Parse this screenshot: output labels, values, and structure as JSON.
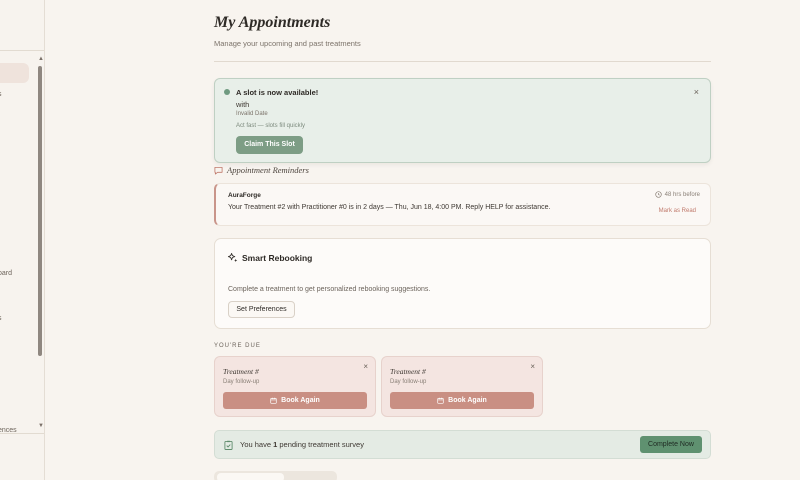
{
  "sidebar": {
    "fragments": [
      {
        "text": "s"
      },
      {
        "text": "oard"
      },
      {
        "text": "s"
      },
      {
        "text": "ences"
      }
    ]
  },
  "page": {
    "title": "My Appointments",
    "subtitle": "Manage your upcoming and past treatments"
  },
  "slot_alert": {
    "title": "A slot is now available!",
    "with_text": "with",
    "date_text": "Invalid Date",
    "hint": "Act fast — slots fill quickly",
    "button_label": "Claim This Slot",
    "close_glyph": "×",
    "dot_color": "#6f9a80"
  },
  "reminders": {
    "heading": "Appointment Reminders",
    "items": [
      {
        "from": "AuraForge",
        "time": "48 hrs before",
        "message": "Your Treatment #2 with Practitioner #0 is in 2 days — Thu, Jun 18, 4:00 PM. Reply HELP for assistance.",
        "action": "Mark as Read"
      }
    ]
  },
  "smart_rebooking": {
    "title": "Smart Rebooking",
    "body": "Complete a treatment to get personalized rebooking suggestions.",
    "button_label": "Set Preferences"
  },
  "due": {
    "label": "YOU'RE DUE",
    "cards": [
      {
        "name": "Treatment #",
        "subtitle": "Day follow-up",
        "button_label": "Book Again",
        "close_glyph": "×"
      },
      {
        "name": "Treatment #",
        "subtitle": "Day follow-up",
        "button_label": "Book Again",
        "close_glyph": "×"
      }
    ]
  },
  "survey": {
    "text_prefix": "You have ",
    "count": "1",
    "text_suffix": " pending treatment survey",
    "button_label": "Complete Now"
  },
  "colors": {
    "accent_green": "#7d9d85",
    "accent_rose": "#c98f83",
    "background": "#f8f4ef"
  }
}
